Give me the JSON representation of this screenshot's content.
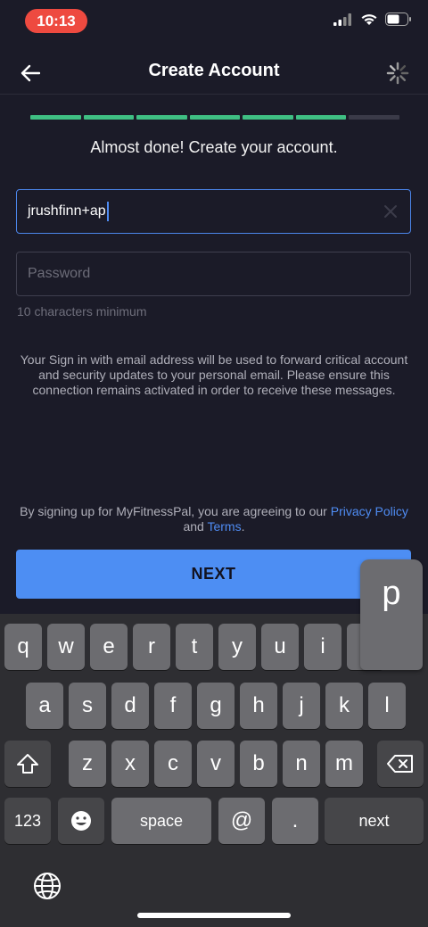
{
  "status_bar": {
    "time": "10:13"
  },
  "header": {
    "title": "Create Account"
  },
  "progress": {
    "total_steps": 7,
    "completed_steps": 6
  },
  "subtitle": "Almost done! Create your account.",
  "email_field": {
    "value": "jrushfinn+ap"
  },
  "password_field": {
    "placeholder": "Password",
    "value": ""
  },
  "password_hint": "10 characters minimum",
  "notice": "Your Sign in with email address will be used to forward critical account and security updates to your personal email. Please ensure this connection remains activated in order to receive these messages.",
  "legal": {
    "prefix": "By signing up for MyFitnessPal, you are agreeing to our ",
    "privacy_link": "Privacy Policy",
    "middle": " and ",
    "terms_link": "Terms",
    "suffix": "."
  },
  "next_button": "NEXT",
  "keyboard": {
    "row1": [
      "q",
      "w",
      "e",
      "r",
      "t",
      "y",
      "u",
      "i",
      "o",
      "p"
    ],
    "row2": [
      "a",
      "s",
      "d",
      "f",
      "g",
      "h",
      "j",
      "k",
      "l"
    ],
    "row3": [
      "z",
      "x",
      "c",
      "v",
      "b",
      "n",
      "m"
    ],
    "numbers_key": "123",
    "space_key": "space",
    "at_key": "@",
    "dot_key": ".",
    "return_key": "next",
    "popup_letter": "p"
  },
  "colors": {
    "accent": "#4d8ef3",
    "progress_done": "#3fbf83",
    "time_pill": "#ee4a40",
    "background": "#1b1b28"
  }
}
